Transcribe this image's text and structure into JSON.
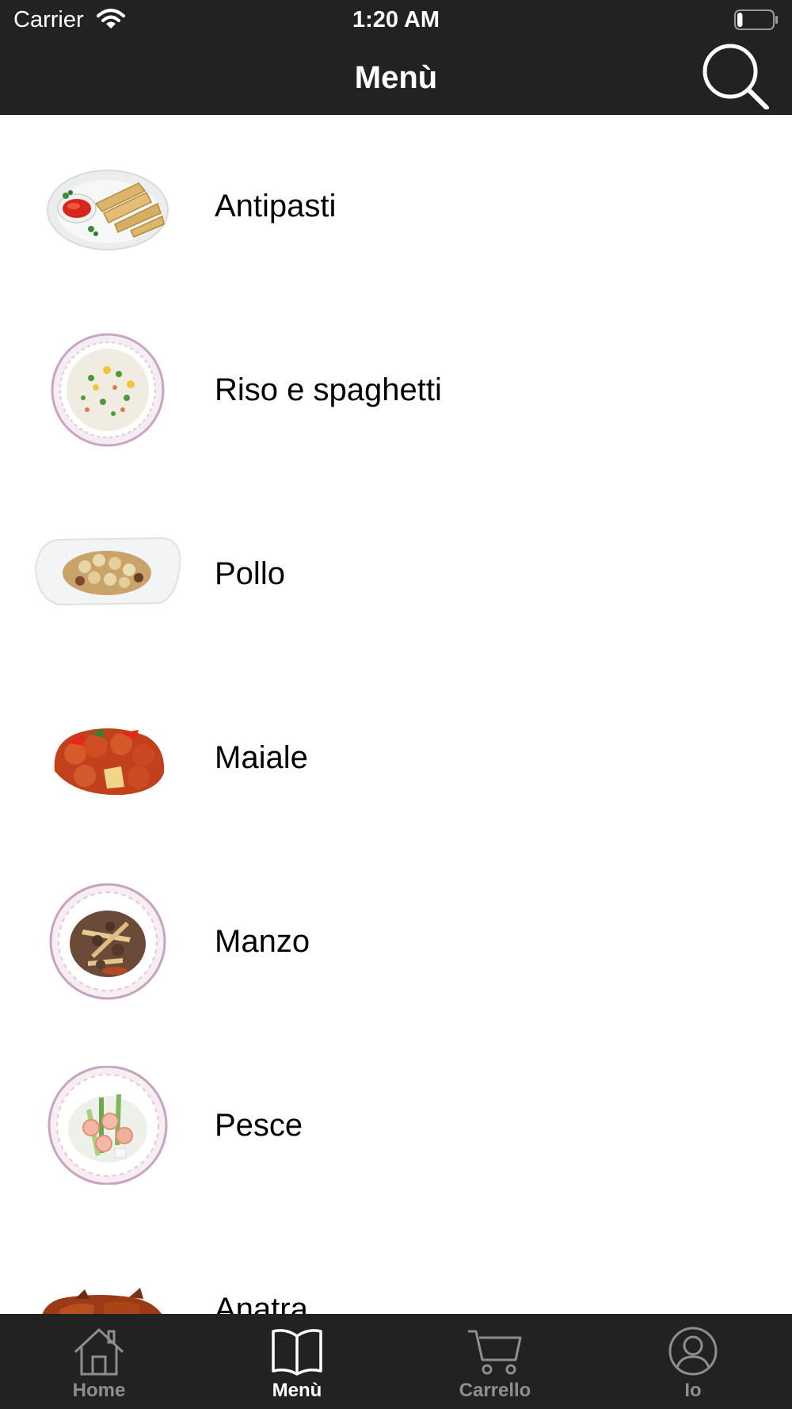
{
  "status_bar": {
    "carrier": "Carrier",
    "time": "1:20 AM",
    "battery_level": 0.15
  },
  "nav_bar": {
    "title": "Menù",
    "search_icon": "search-icon"
  },
  "menu": {
    "items": [
      {
        "label": "Antipasti",
        "image": "spring-rolls-dish"
      },
      {
        "label": "Riso e spaghetti",
        "image": "fried-rice-plate"
      },
      {
        "label": "Pollo",
        "image": "chicken-cashew-plate"
      },
      {
        "label": "Maiale",
        "image": "sweet-sour-pork"
      },
      {
        "label": "Manzo",
        "image": "beef-bamboo-plate"
      },
      {
        "label": "Pesce",
        "image": "shrimp-plate"
      },
      {
        "label": "Anatra",
        "image": "roast-duck"
      }
    ]
  },
  "tab_bar": {
    "tabs": [
      {
        "label": "Home",
        "icon": "home-icon",
        "active": false
      },
      {
        "label": "Menù",
        "icon": "book-icon",
        "active": true
      },
      {
        "label": "Carrello",
        "icon": "cart-icon",
        "active": false
      },
      {
        "label": "Io",
        "icon": "user-icon",
        "active": false
      }
    ]
  },
  "colors": {
    "bar_background": "#222222",
    "active_tab": "#ffffff",
    "inactive_tab": "#8e8e8e"
  }
}
